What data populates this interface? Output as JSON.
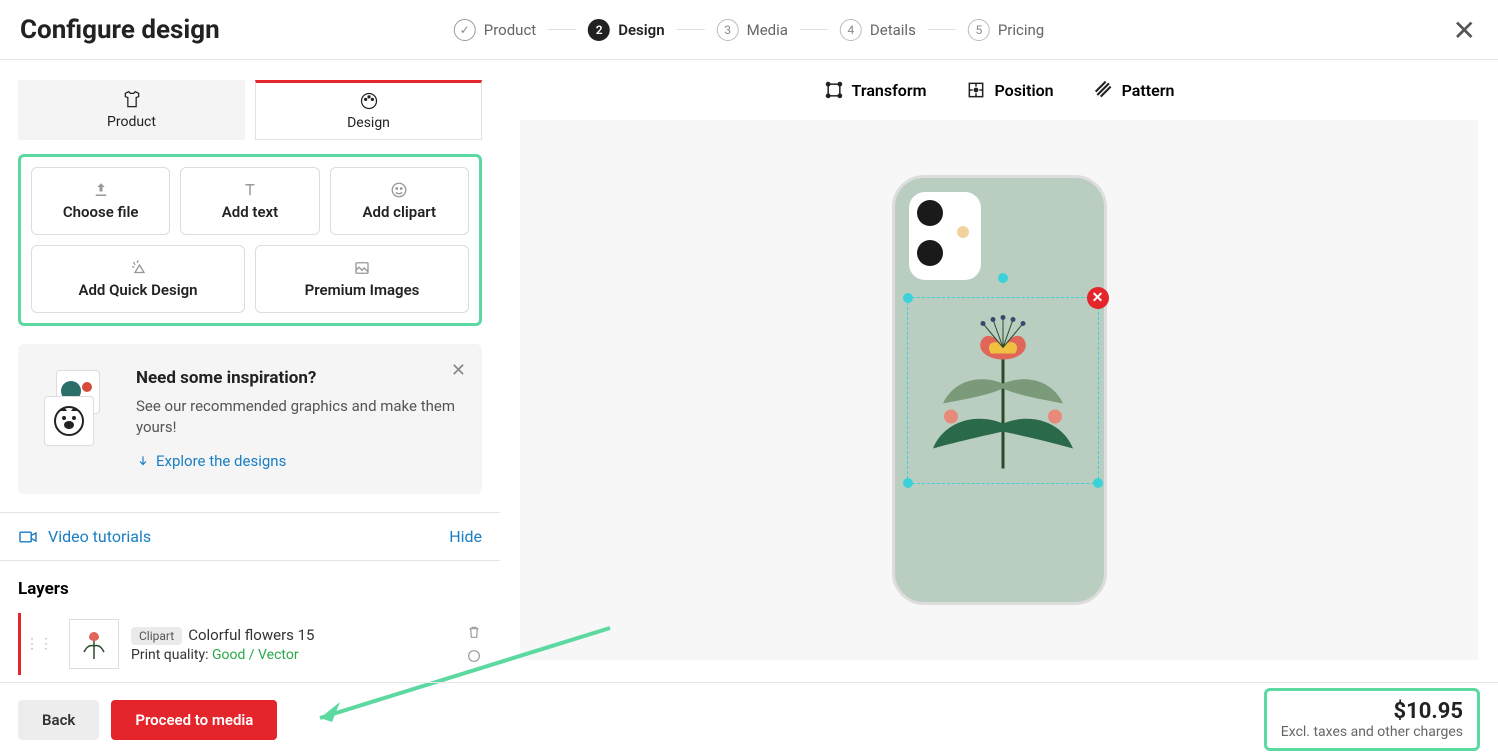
{
  "title": "Configure design",
  "steps": [
    {
      "num": "✓",
      "label": "Product",
      "state": "done"
    },
    {
      "num": "2",
      "label": "Design",
      "state": "active"
    },
    {
      "num": "3",
      "label": "Media",
      "state": ""
    },
    {
      "num": "4",
      "label": "Details",
      "state": ""
    },
    {
      "num": "5",
      "label": "Pricing",
      "state": ""
    }
  ],
  "tabs": {
    "product": "Product",
    "design": "Design"
  },
  "options": {
    "choose_file": "Choose file",
    "add_text": "Add text",
    "add_clipart": "Add clipart",
    "add_quick": "Add Quick Design",
    "premium": "Premium Images"
  },
  "inspire": {
    "title": "Need some inspiration?",
    "desc": "See our recommended graphics and make them yours!",
    "explore": "Explore the designs"
  },
  "video_tutorials": "Video tutorials",
  "hide": "Hide",
  "layers_title": "Layers",
  "layer": {
    "badge": "Clipart",
    "name": "Colorful flowers 15",
    "pq_label": "Print quality: ",
    "pq_val": "Good / Vector"
  },
  "toolbar": {
    "transform": "Transform",
    "position": "Position",
    "pattern": "Pattern"
  },
  "footer": {
    "back": "Back",
    "proceed": "Proceed to media"
  },
  "price": {
    "amount": "$10.95",
    "sub": "Excl. taxes and other charges"
  }
}
